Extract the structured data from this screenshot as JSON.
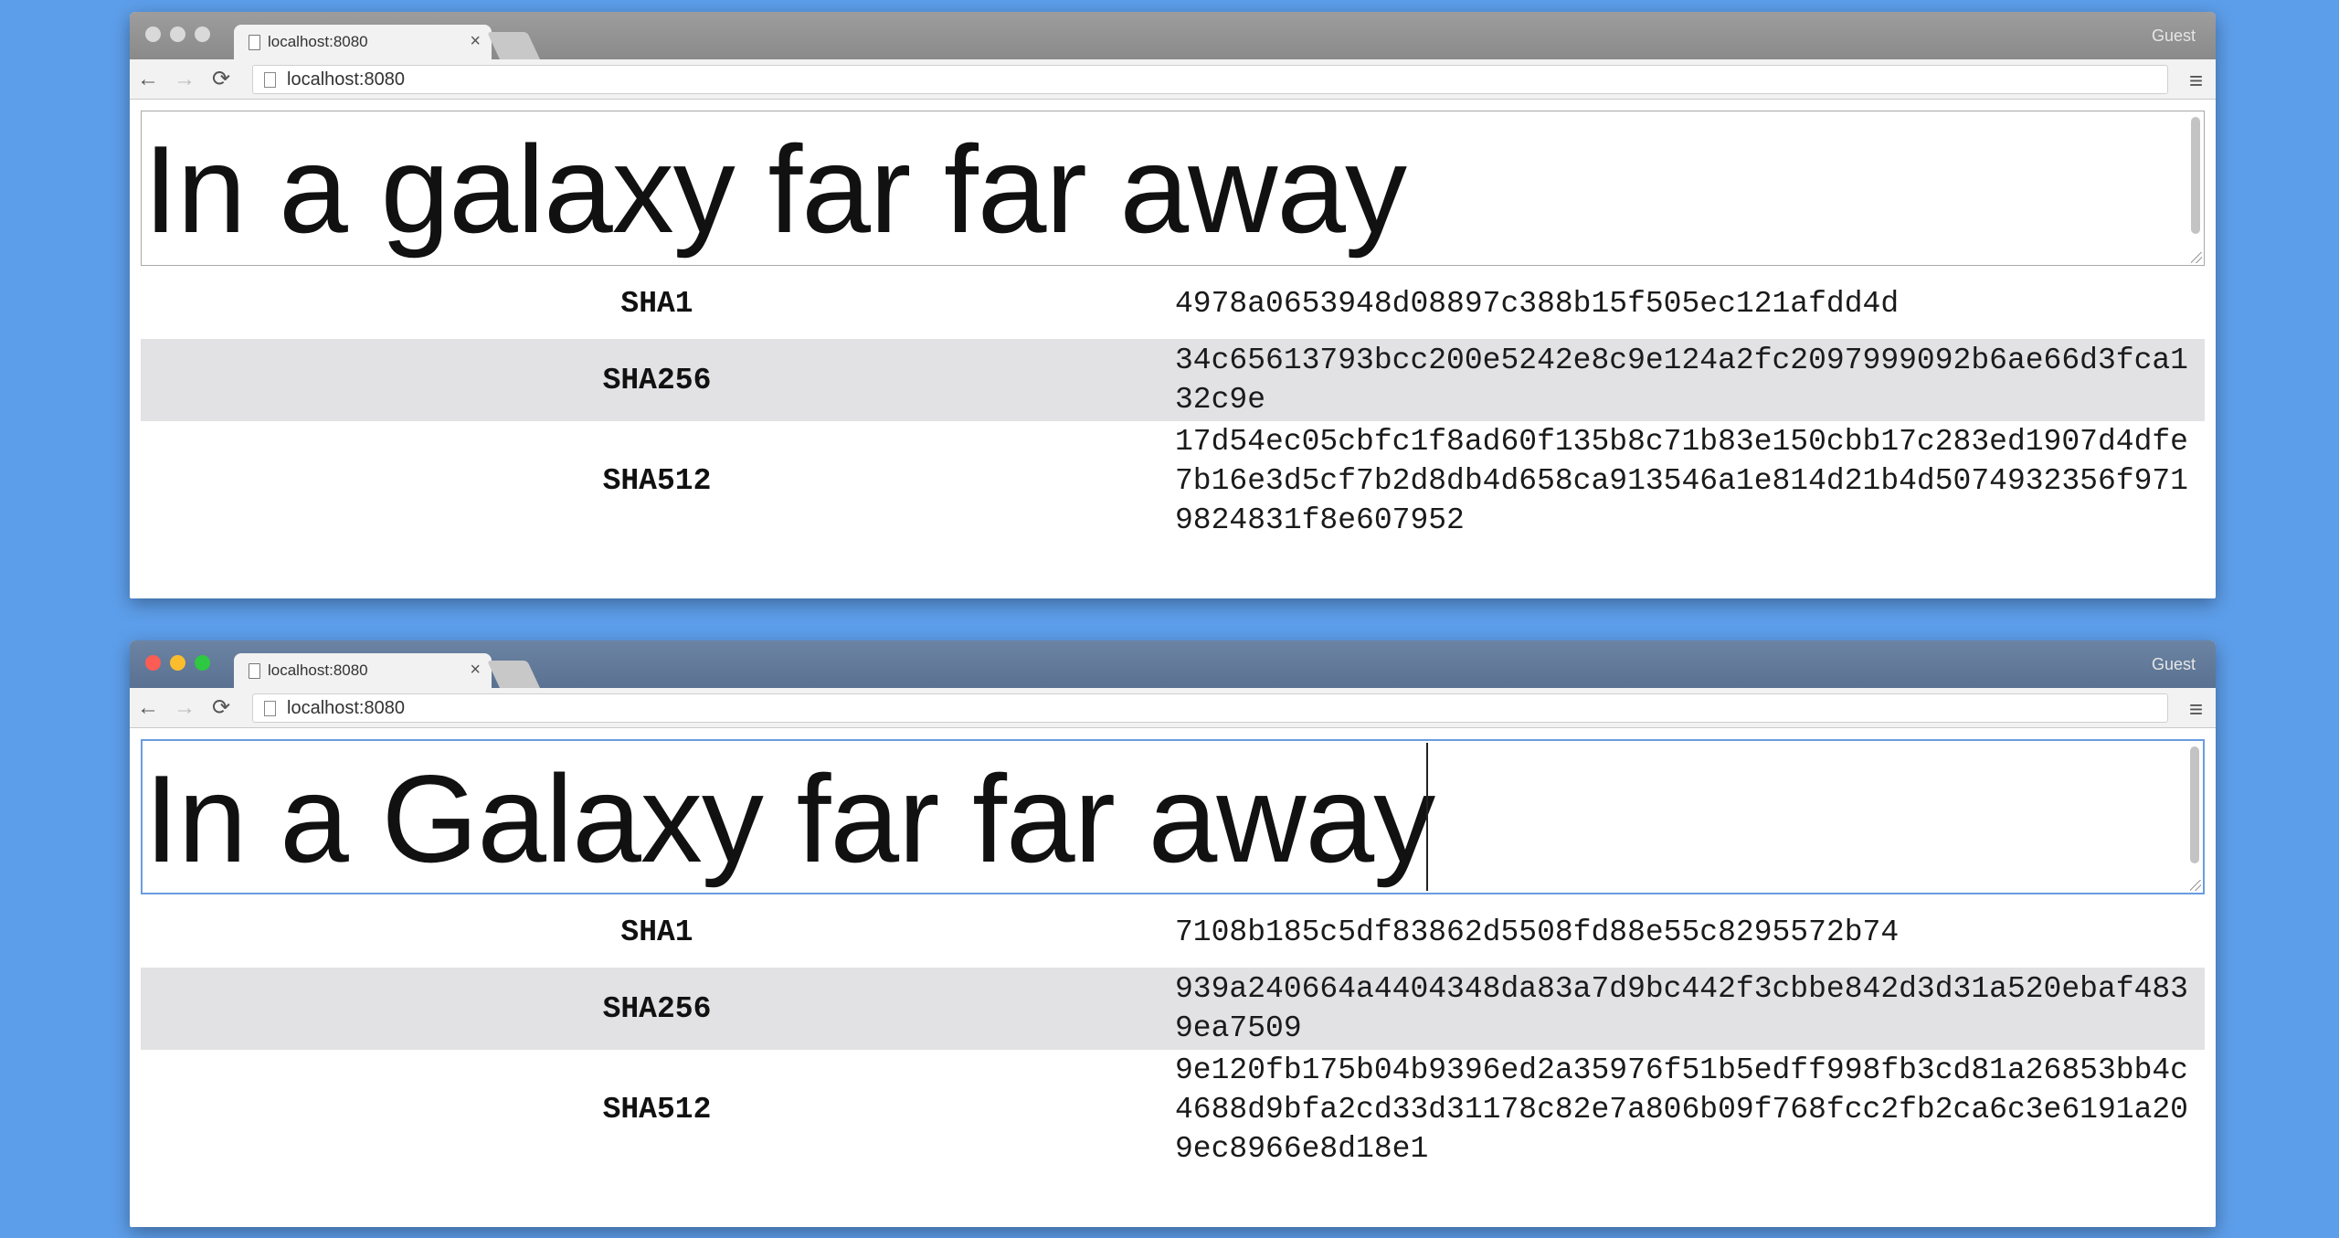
{
  "windows": [
    {
      "tab_title": "localhost:8080",
      "tab_close": "×",
      "guest_label": "Guest",
      "url": "localhost:8080",
      "textarea_text": "In a galaxy far far away",
      "hashes": [
        {
          "algo": "SHA1",
          "value": "4978a0653948d08897c388b15f505ec121afdd4d"
        },
        {
          "algo": "SHA256",
          "value": "34c65613793bcc200e5242e8c9e124a2fc2097999092b6ae66d3fca132c9e"
        },
        {
          "algo": "SHA512",
          "value": "17d54ec05cbfc1f8ad60f135b8c71b83e150cbb17c283ed1907d4dfe7b16e3d5cf7b2d8db4d658ca913546a1e814d21b4d5074932356f9719824831f8e607952"
        }
      ]
    },
    {
      "tab_title": "localhost:8080",
      "tab_close": "×",
      "guest_label": "Guest",
      "url": "localhost:8080",
      "textarea_text": "In a Galaxy far far away",
      "hashes": [
        {
          "algo": "SHA1",
          "value": "7108b185c5df83862d5508fd88e55c8295572b74"
        },
        {
          "algo": "SHA256",
          "value": "939a240664a4404348da83a7d9bc442f3cbbe842d3d31a520ebaf4839ea7509"
        },
        {
          "algo": "SHA512",
          "value": "9e120fb175b04b9396ed2a35976f51b5edff998fb3cd81a26853bb4c4688d9bfa2cd33d31178c82e7a806b09f768fcc2fb2ca6c3e6191a209ec8966e8d18e1"
        }
      ]
    }
  ],
  "icons": {
    "back": "←",
    "forward": "→",
    "reload": "⟳",
    "menu": "≡"
  },
  "colors": {
    "desktop": "#5d9eea",
    "focus_ring": "#6a9de0",
    "zebra_row": "#e2e2e4"
  }
}
